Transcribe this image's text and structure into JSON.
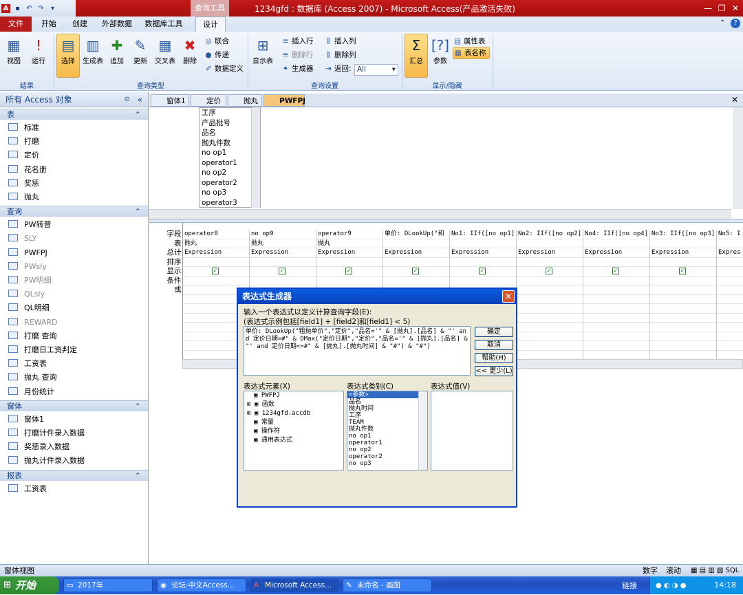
{
  "window": {
    "title": "1234gfd : 数据库 (Access 2007) - Microsoft Access(产品激活失败)",
    "context_tab": "查询工具"
  },
  "tabs": [
    "文件",
    "开始",
    "创建",
    "外部数据",
    "数据库工具",
    "设计"
  ],
  "ribbon": {
    "big_buttons": [
      "视图",
      "运行",
      "选择",
      "生成表",
      "追加",
      "更新",
      "交叉表",
      "删除",
      "显示表",
      "汇总",
      "参数"
    ],
    "small_a": [
      "联合",
      "传递",
      "数据定义"
    ],
    "small_b": [
      "插入行",
      "删除行",
      "生成器"
    ],
    "small_c": [
      "插入列",
      "删除列",
      "返回:"
    ],
    "return_value": "All",
    "small_d": [
      "属性表",
      "表名称"
    ],
    "groups": [
      "结果",
      "查询类型",
      "查询设置",
      "显示/隐藏"
    ]
  },
  "nav": {
    "title": "所有 Access 对象",
    "sections": [
      {
        "name": "表",
        "items": [
          "标准",
          "打磨",
          "定价",
          "花名册",
          "奖惩",
          "抛丸"
        ]
      },
      {
        "name": "查询",
        "items": [
          "PW转普",
          "SLY",
          "PWFPJ",
          "PWsly",
          "PW明细",
          "QLsly",
          "QL明细",
          "REWARD",
          "打磨 查询",
          "打磨日工资判定",
          "工资表",
          "抛丸 查询",
          "月份统计"
        ]
      },
      {
        "name": "窗体",
        "items": [
          "窗体1",
          "打磨计件录入数据",
          "奖惩录入数据",
          "抛丸计件录入数据"
        ]
      },
      {
        "name": "报表",
        "items": [
          "工资表"
        ]
      }
    ]
  },
  "doc_tabs": [
    "窗体1",
    "定价",
    "抛丸",
    "PWFPJ"
  ],
  "field_list": [
    "工序",
    "产品批号",
    "品名",
    "抛丸件数",
    "no op1",
    "operator1",
    "no op2",
    "operator2",
    "no op3",
    "operator3"
  ],
  "grid": {
    "row_labels": [
      "字段:",
      "表:",
      "总计:",
      "排序:",
      "显示:",
      "条件:",
      "或:"
    ],
    "columns": [
      {
        "field": "operator8",
        "table": "抛丸",
        "total": "Expression"
      },
      {
        "field": "no op9",
        "table": "抛丸",
        "total": "Expression"
      },
      {
        "field": "operator9",
        "table": "抛丸",
        "total": "Expression"
      },
      {
        "field": "单价: DLookUp(\"和",
        "table": "",
        "total": "Expression"
      },
      {
        "field": "No1: IIf([no op1] :",
        "table": "",
        "total": "Expression"
      },
      {
        "field": "No2: IIf([no op2] :",
        "table": "",
        "total": "Expression"
      },
      {
        "field": "No4: IIf([no op4] :",
        "table": "",
        "total": "Expression"
      },
      {
        "field": "No3: IIf([no op3] :",
        "table": "",
        "total": "Expression"
      },
      {
        "field": "No5: I",
        "table": "",
        "total": "Expres"
      }
    ]
  },
  "dialog": {
    "title": "表达式生成器",
    "instruction": "输入一个表达式以定义计算查询字段(E):",
    "example": "(表达式示例包括[field1] + [field2]和[field1] < 5)",
    "expression": "单价: DLookUp(\"粗抛单价\",\"定价\",\"品名='\" & [抛丸].[品名] & \"' and 定价日期=#\" & DMax(\"定价日期\",\"定价\",\"品名='\" & [抛丸].[品名] & \"' and 定价日期<=#\" & [抛丸].[抛丸时间] & \"#\") & \"#\")",
    "buttons": [
      "确定",
      "取消",
      "帮助(H)",
      "<< 更少(L)"
    ],
    "elements_label": "表达式元素(X)",
    "categories_label": "表达式类别(C)",
    "values_label": "表达式值(V)",
    "elements": [
      "PWFPJ",
      "函数",
      "1234gfd.accdb",
      "常量",
      "操作符",
      "通用表达式"
    ],
    "categories": [
      "<参数>",
      "品名",
      "抛丸时间",
      "工序",
      "TEAM",
      "抛丸件数",
      "no op1",
      "operator1",
      "no op2",
      "operator2",
      "no op3"
    ]
  },
  "status": {
    "left": "窗体视图",
    "right1": "数字",
    "right2": "滚动"
  },
  "taskbar": {
    "start": "开始",
    "items": [
      "2017年",
      "论坛-中文Access...",
      "Microsoft Access...",
      "未命名 - 画图"
    ],
    "links": "链接",
    "clock": "14:18"
  }
}
